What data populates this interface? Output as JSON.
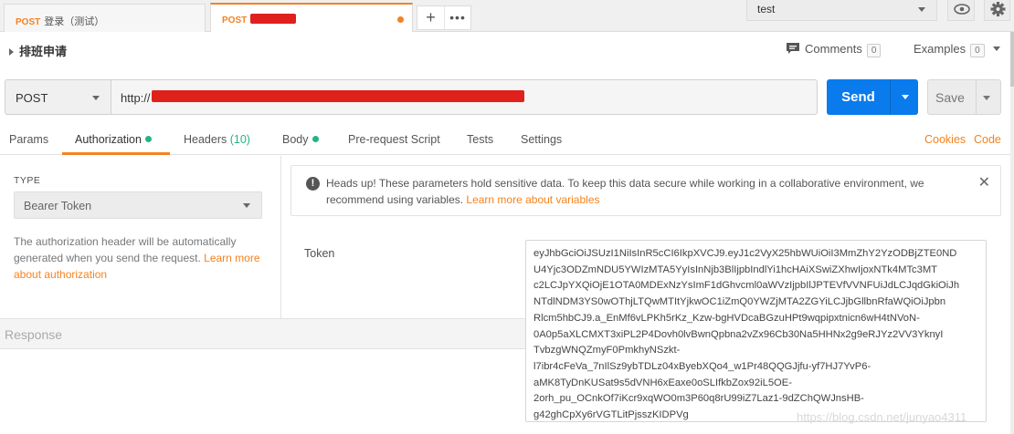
{
  "tabs": [
    {
      "method": "POST",
      "title": "登录（测试）"
    },
    {
      "method": "POST",
      "title": ""
    }
  ],
  "new_tab_icon": "+",
  "more_icon": "•••",
  "environment": "test",
  "request": {
    "name": "排班申请",
    "comments_label": "Comments",
    "comments_count": "0",
    "examples_label": "Examples",
    "examples_count": "0",
    "method": "POST",
    "url_prefix": "http://",
    "send_label": "Send",
    "save_label": "Save"
  },
  "subtabs": {
    "params": "Params",
    "authorization": "Authorization",
    "headers": "Headers",
    "headers_count": "(10)",
    "body": "Body",
    "prerequest": "Pre-request Script",
    "tests": "Tests",
    "settings": "Settings",
    "cookies": "Cookies",
    "code": "Code"
  },
  "auth": {
    "type_label": "TYPE",
    "type_value": "Bearer Token",
    "description": "The authorization header will be automatically generated when you send the request. ",
    "learn_more": "Learn more about authorization"
  },
  "banner": {
    "text": "Heads up! These parameters hold sensitive data. To keep this data secure while working in a collaborative environment, we recommend using variables. ",
    "link": "Learn more about variables"
  },
  "token": {
    "label": "Token",
    "lines": [
      "eyJhbGciOiJSUzI1NiIsInR5cCI6IkpXVCJ9.eyJ1c2VyX25hbWUiOiI3MmZhY2YzODBjZTE0ND",
      "U4Yjc3ODZmNDU5YWIzMTA5YyIsInNjb3BlIjpbIndlYi1hcHAiXSwiZXhwIjoxNTk4MTc3MT",
      "c2LCJpYXQiOjE1OTA0MDExNzYsImF1dGhvcml0aWVzIjpbIlJPTEVfVVNFUiJdLCJqdGkiOiJh",
      "NTdlNDM3YS0wOThjLTQwMTItYjkwOC1iZmQ0YWZjMTA2ZGYiLCJjbGllbnRfaWQiOiJpbn",
      "Rlcm5hbCJ9.a_EnMf6vLPKh5rKz_Kzw-bgHVDcaBGzuHPt9wqpipxtnicn6wH4tNVoN-",
      "0A0p5aXLCMXT3xiPL2P4Dovh0lvBwnQpbna2vZx96Cb30Na5HHNx2g9eRJYz2VV3YknyI",
      "TvbzgWNQZmyF0PmkhyNSzkt-",
      "l7ibr4cFeVa_7nIlSz9ybTDLz04xByebXQo4_w1Pr48QQGJjfu-yf7HJ7YvP6-",
      "aMK8TyDnKUSat9s5dVNH6xEaxe0oSLIfkbZox92iL5OE-",
      "2orh_pu_OCnkOf7iKcr9xqWO0m3P60q8rU99iZ7Laz1-9dZChQWJnsHB-",
      "g42ghCpXy6rVGTLitPjsszKIDPVg"
    ]
  },
  "response_label": "Response",
  "watermark": "https://blog.csdn.net/junyao4311",
  "colors": {
    "accent": "#f5821f",
    "send_blue": "#097bed",
    "redaction": "#e0201b",
    "status_green": "#26b47f"
  },
  "icons": {
    "env_eye": "eye-icon",
    "settings": "gear-icon",
    "comments": "comment-icon",
    "info": "info-icon",
    "close": "close-icon"
  }
}
